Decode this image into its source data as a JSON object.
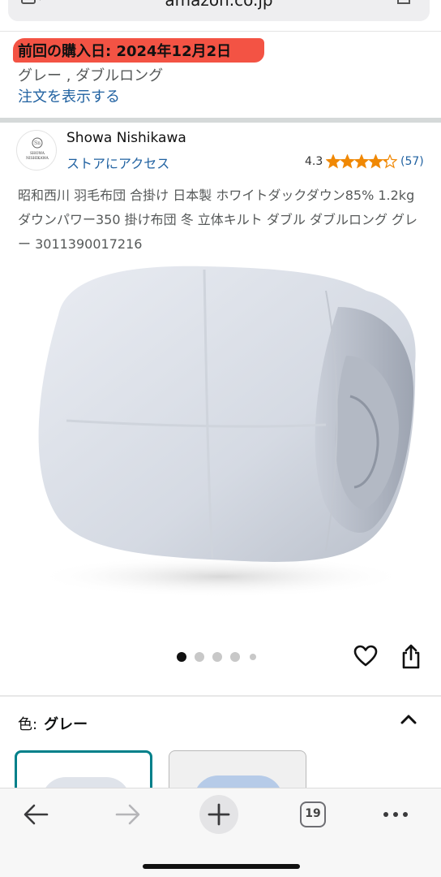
{
  "browser": {
    "url": "amazon.co.jp",
    "tabs_count": "19"
  },
  "purchase": {
    "last_purchase": "前回の購入日: 2024年12月2日",
    "variant": "グレー , ダブルロング",
    "view_order": "注文を表示する"
  },
  "store": {
    "brand": "Showa Nishikawa",
    "logo_text": "SHOWA NISHIKAWA",
    "store_link": "ストアにアクセス",
    "rating": "4.3",
    "rating_count": "(57)",
    "stars_filled": 4.3
  },
  "product": {
    "title": "昭和西川 羽毛布団 合掛け 日本製 ホワイトダックダウン85% 1.2kg ダウンパワー350 掛け布団 冬 立体キルト ダブル ダブルロング グレー 3011390017216",
    "image_count": 5,
    "active_image": 1
  },
  "variation": {
    "color_label": "色:",
    "color_value": "グレー"
  },
  "colors": {
    "highlight": "#f24a3a",
    "link": "#2162a1",
    "star": "#f08804",
    "selected_border": "#00808a"
  },
  "icons": [
    "reader-icon",
    "share-icon",
    "star-icon",
    "heart-icon",
    "chevron-up-icon",
    "back-arrow-icon",
    "forward-arrow-icon",
    "plus-icon",
    "tabs-icon",
    "more-icon"
  ]
}
